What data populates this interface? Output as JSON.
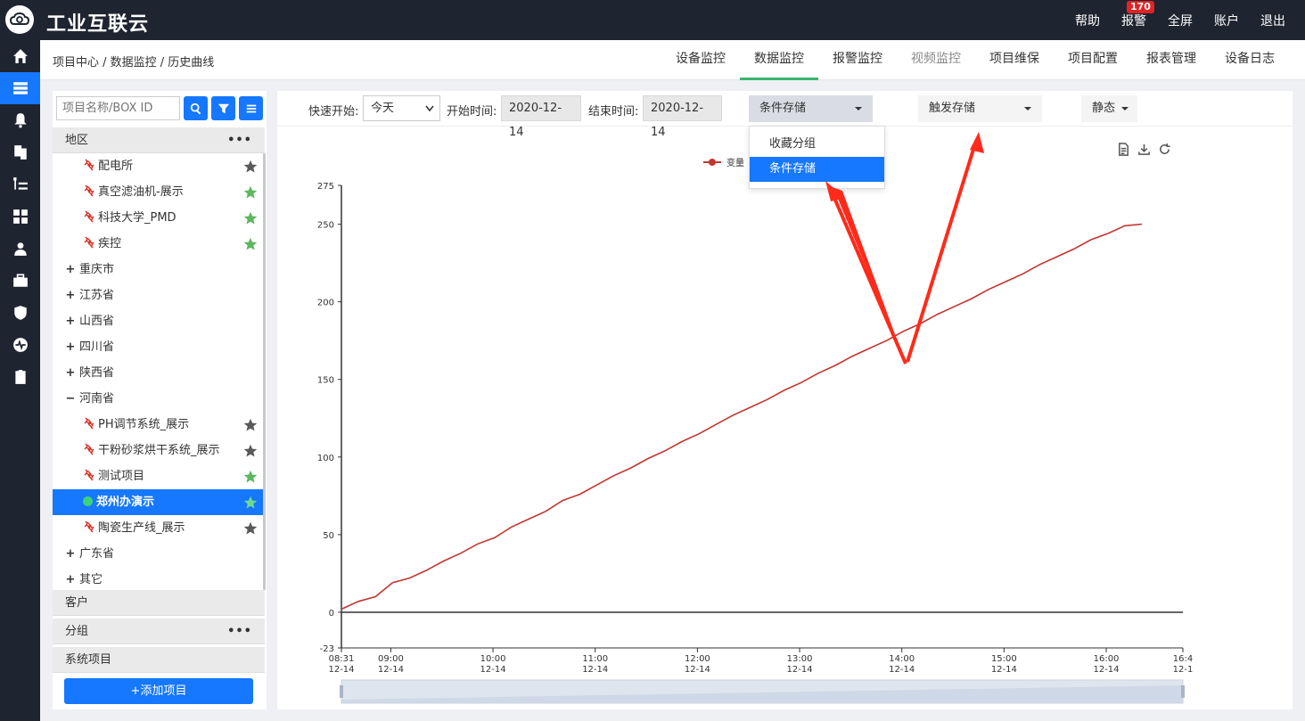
{
  "app": {
    "brand": "工业互联云",
    "top_links": [
      {
        "label": "帮助"
      },
      {
        "label": "报警",
        "badge": "170"
      },
      {
        "label": "全屏"
      },
      {
        "label": "账户"
      },
      {
        "label": "退出"
      }
    ]
  },
  "breadcrumb": "项目中心 / 数据监控 / 历史曲线",
  "tabs": [
    {
      "label": "设备监控"
    },
    {
      "label": "数据监控"
    },
    {
      "label": "报警监控"
    },
    {
      "label": "视频监控"
    },
    {
      "label": "项目维保"
    },
    {
      "label": "项目配置"
    },
    {
      "label": "报表管理"
    },
    {
      "label": "设备日志"
    }
  ],
  "sidebar": {
    "search_placeholder": "项目名称/BOX ID",
    "section_region": "地区",
    "section_more": "•••",
    "tree": [
      {
        "label": "配电所",
        "type": "leaf",
        "star": "gray"
      },
      {
        "label": "真空滤油机-展示",
        "type": "leaf",
        "star": "green"
      },
      {
        "label": "科技大学_PMD",
        "type": "leaf",
        "star": "green"
      },
      {
        "label": "疾控",
        "type": "leaf",
        "star": "green"
      },
      {
        "label": "重庆市",
        "type": "group",
        "sign": "+"
      },
      {
        "label": "江苏省",
        "type": "group",
        "sign": "+"
      },
      {
        "label": "山西省",
        "type": "group",
        "sign": "+"
      },
      {
        "label": "四川省",
        "type": "group",
        "sign": "+"
      },
      {
        "label": "陕西省",
        "type": "group",
        "sign": "+"
      },
      {
        "label": "河南省",
        "type": "group",
        "sign": "−"
      },
      {
        "label": "PH调节系统_展示",
        "type": "leaf",
        "star": "gray"
      },
      {
        "label": "干粉砂浆烘干系统_展示",
        "type": "leaf",
        "star": "gray"
      },
      {
        "label": "测试项目",
        "type": "leaf",
        "star": "green"
      },
      {
        "label": "郑州办演示",
        "type": "selected",
        "star": "green"
      },
      {
        "label": "陶瓷生产线_展示",
        "type": "leaf",
        "star": "gray"
      },
      {
        "label": "广东省",
        "type": "group",
        "sign": "+"
      },
      {
        "label": "其它",
        "type": "group",
        "sign": "+"
      }
    ],
    "section_customer": "客户",
    "section_group": "分组",
    "section_system": "系统项目",
    "add_button": "+添加项目"
  },
  "filters": {
    "quick_start_label": "快速开始:",
    "quick_start_value": "今天",
    "start_label": "开始时间:",
    "start_value": "2020-12-14",
    "end_label": "结束时间:",
    "end_value": "2020-12-14",
    "storage_mode": "条件存储",
    "trigger_mode": "触发存储",
    "static_mode": "静态",
    "storage_options": [
      "收藏分组",
      "条件存储"
    ],
    "selected_option": "条件存储"
  },
  "colors": {
    "brand_dark": "#1f2530",
    "accent_blue": "#1677ff",
    "series_red": "#c23531",
    "tab_active_green": "#3cb371",
    "annotation_red": "#ff2a1a"
  },
  "chart_data": {
    "type": "line",
    "legend_entry": "变量",
    "ylim": [
      -23,
      275
    ],
    "y_ticks": [
      "275",
      "250",
      "200",
      "150",
      "100",
      "50",
      "0",
      "-23"
    ],
    "x_ticks": [
      {
        "time": "08:31",
        "date": "12-14"
      },
      {
        "time": "09:00",
        "date": "12-14"
      },
      {
        "time": "10:00",
        "date": "12-14"
      },
      {
        "time": "11:00",
        "date": "12-14"
      },
      {
        "time": "12:00",
        "date": "12-14"
      },
      {
        "time": "13:00",
        "date": "12-14"
      },
      {
        "time": "14:00",
        "date": "12-14"
      },
      {
        "time": "15:00",
        "date": "12-14"
      },
      {
        "time": "16:00",
        "date": "12-14"
      },
      {
        "time": "16:4",
        "date": "12-1"
      }
    ],
    "x_minutes": [
      0,
      29,
      89,
      149,
      209,
      269,
      329,
      389,
      449,
      494
    ],
    "series": [
      {
        "values": [
          [
            0,
            2
          ],
          [
            10,
            7
          ],
          [
            20,
            10
          ],
          [
            30,
            19
          ],
          [
            40,
            22
          ],
          [
            50,
            27
          ],
          [
            60,
            33
          ],
          [
            70,
            38
          ],
          [
            80,
            44
          ],
          [
            90,
            48
          ],
          [
            100,
            55
          ],
          [
            110,
            60
          ],
          [
            120,
            65
          ],
          [
            130,
            72
          ],
          [
            140,
            76
          ],
          [
            150,
            82
          ],
          [
            160,
            88
          ],
          [
            170,
            93
          ],
          [
            180,
            99
          ],
          [
            190,
            104
          ],
          [
            200,
            110
          ],
          [
            210,
            115
          ],
          [
            220,
            121
          ],
          [
            230,
            127
          ],
          [
            240,
            132
          ],
          [
            250,
            137
          ],
          [
            260,
            143
          ],
          [
            270,
            148
          ],
          [
            280,
            154
          ],
          [
            290,
            159
          ],
          [
            300,
            165
          ],
          [
            310,
            170
          ],
          [
            320,
            175
          ],
          [
            330,
            181
          ],
          [
            340,
            186
          ],
          [
            350,
            192
          ],
          [
            360,
            197
          ],
          [
            370,
            202
          ],
          [
            380,
            208
          ],
          [
            390,
            213
          ],
          [
            400,
            218
          ],
          [
            410,
            224
          ],
          [
            420,
            229
          ],
          [
            430,
            234
          ],
          [
            440,
            240
          ],
          [
            450,
            244
          ],
          [
            460,
            249
          ],
          [
            470,
            250
          ]
        ]
      }
    ]
  }
}
